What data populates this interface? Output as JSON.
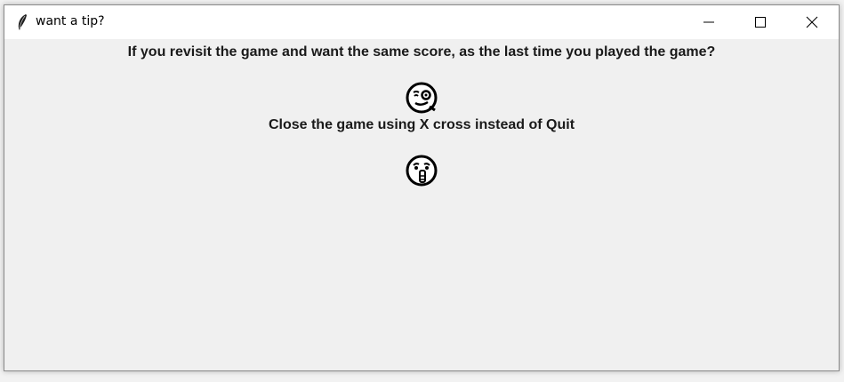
{
  "window": {
    "title": "want a tip?",
    "controls": {
      "minimize_icon": "minimize-icon",
      "maximize_icon": "maximize-icon",
      "close_icon": "close-icon"
    }
  },
  "content": {
    "question": "If you revisit the game and want the same score, as the last time you played the game?",
    "tip": "Close the game using X cross instead of Quit",
    "emoji_1": "winking-face-icon",
    "emoji_2": "shushing-face-icon"
  },
  "colors": {
    "window_bg": "#f0f0f0",
    "titlebar_bg": "#ffffff",
    "text": "#1a1a1a"
  }
}
